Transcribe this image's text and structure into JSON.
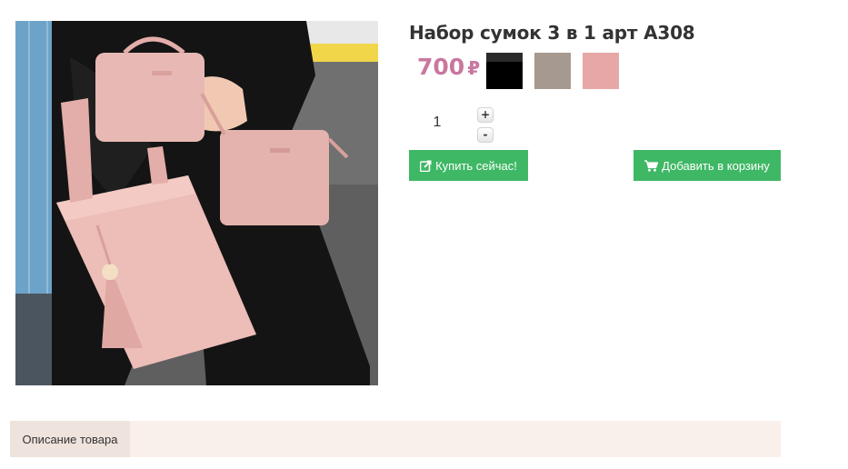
{
  "product": {
    "title": "Набор сумок 3 в 1 арт А308",
    "price": "700",
    "currency": "₽",
    "image": "product-photo-pink-bags"
  },
  "colors": [
    {
      "name": "black",
      "hex": "#000000"
    },
    {
      "name": "taupe",
      "hex": "#a69990"
    },
    {
      "name": "pink",
      "hex": "#e6a7a6"
    }
  ],
  "quantity": {
    "value": "1",
    "plus_label": "+",
    "minus_label": "-"
  },
  "actions": {
    "buy_now_label": "Купить сейчас!",
    "buy_now_icon": "external-link-icon",
    "add_to_cart_label": "Добавить в корзину",
    "add_to_cart_icon": "shopping-cart-icon"
  },
  "tabs": [
    {
      "label": "Описание товара",
      "active": true
    }
  ],
  "theme": {
    "accent": "#3fb865",
    "price_color": "#c9779f",
    "tab_bg": "#f9f0ec",
    "tab_active_bg": "#efe3dd"
  }
}
